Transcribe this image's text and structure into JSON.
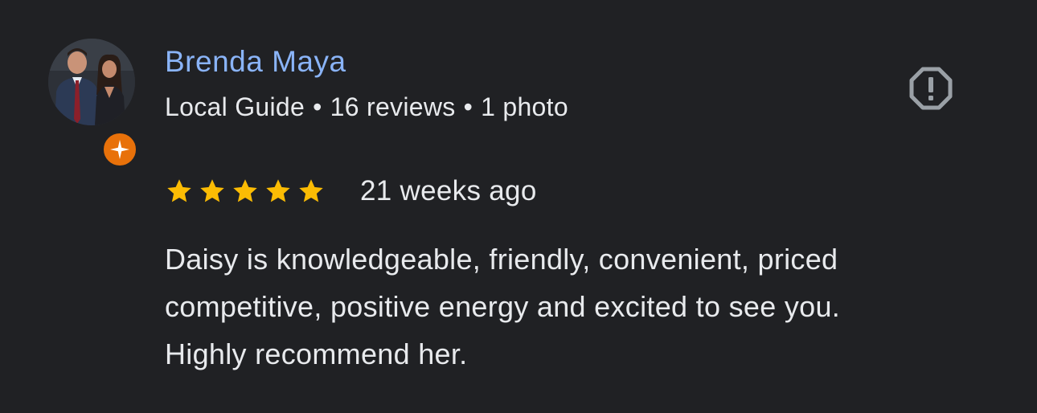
{
  "review": {
    "author": {
      "name": "Brenda Maya",
      "avatar": "profile-photo",
      "badge": "local-guide-star-icon",
      "meta": {
        "level": "Local Guide",
        "reviews": "16 reviews",
        "photos": "1 photo",
        "separator": "•"
      }
    },
    "flag_icon": "report-flag-icon",
    "rating": {
      "stars": 5,
      "max": 5,
      "star_color": "#fbbc04"
    },
    "date": "21 weeks ago",
    "text_lines": [
      "Daisy is knowledgeable, friendly, convenient, priced",
      "competitive, positive energy and excited to see you.",
      "Highly recommend her."
    ]
  },
  "colors": {
    "background": "#202124",
    "name": "#8ab4f8",
    "text": "#e8eaed",
    "badge": "#e8710a",
    "icon": "#9aa0a6"
  }
}
